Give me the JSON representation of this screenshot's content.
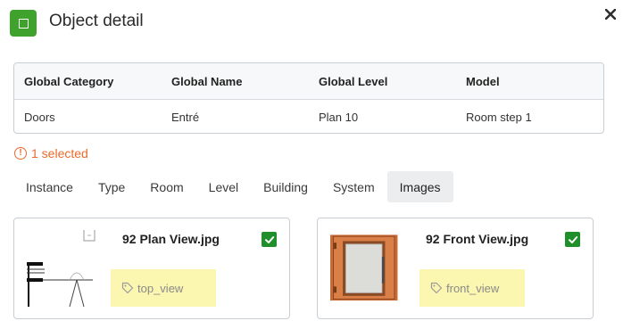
{
  "header": {
    "title": "Object detail"
  },
  "attributes": {
    "columns": [
      "Global Category",
      "Global Name",
      "Global Level",
      "Model"
    ],
    "values": [
      "Doors",
      "Entré",
      "Plan 10",
      "Room step 1"
    ]
  },
  "selection": {
    "text": "1 selected"
  },
  "tabs": [
    {
      "label": "Instance"
    },
    {
      "label": "Type"
    },
    {
      "label": "Room"
    },
    {
      "label": "Level"
    },
    {
      "label": "Building"
    },
    {
      "label": "System"
    },
    {
      "label": "Images",
      "active": true
    }
  ],
  "images": [
    {
      "filename": "92 Plan View.jpg",
      "tag": "top_view",
      "checked": true
    },
    {
      "filename": "92 Front View.jpg",
      "tag": "front_view",
      "checked": true
    }
  ],
  "colors": {
    "accent_green": "#3ea22c",
    "warning": "#ea6b2d",
    "tag_bg": "#fbf6b0",
    "check_green": "#1f8f2c"
  }
}
